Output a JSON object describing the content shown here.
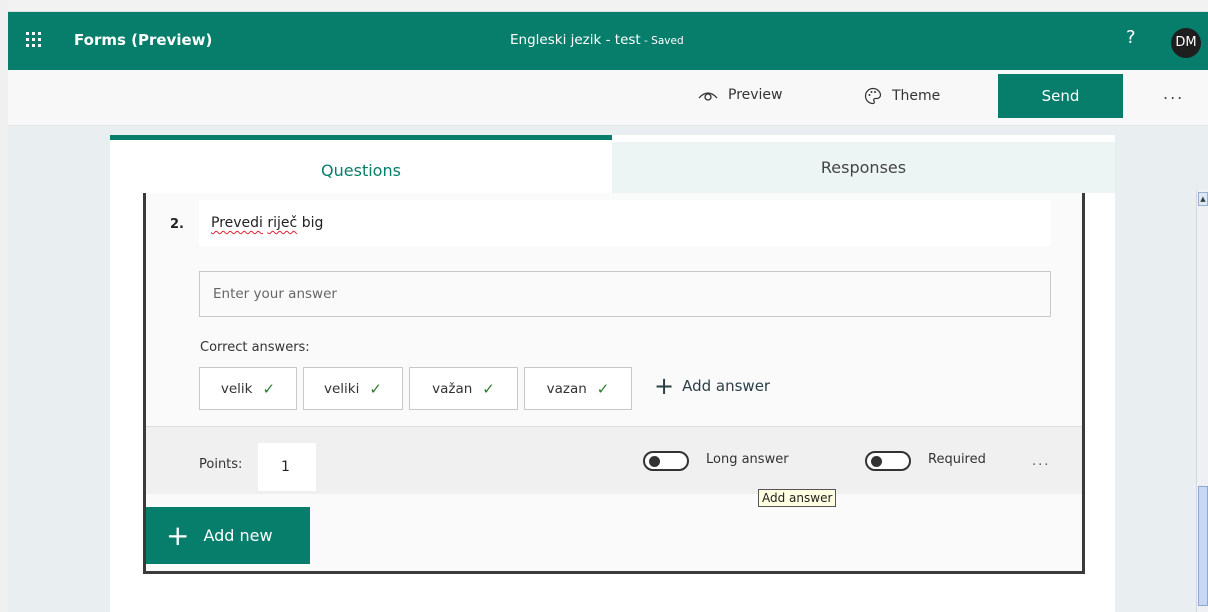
{
  "app_bar": {
    "app_name": "Forms (Preview)",
    "doc_title": "Engleski jezik - test",
    "save_sep": " - ",
    "save_status": "Saved",
    "help": "?",
    "user_initials": "DM",
    "background_color": "#077d6b"
  },
  "command_bar": {
    "preview_label": "Preview",
    "theme_label": "Theme",
    "send_label": "Send",
    "more_label": "..."
  },
  "tabs": {
    "questions": "Questions",
    "responses": "Responses"
  },
  "question": {
    "number": "2.",
    "title_word1": "Prevedi",
    "title_word2": "riječ",
    "title_word3": "big",
    "answer_placeholder": "Enter your answer",
    "correct_answers_label": "Correct answers:",
    "correct_answers": [
      "velik",
      "veliki",
      "važan",
      "vazan"
    ],
    "add_answer_label": "Add answer",
    "tooltip": "Add answer",
    "points_label": "Points:",
    "points_value": "1",
    "long_answer_label": "Long answer",
    "long_answer_on": false,
    "required_label": "Required",
    "required_on": false,
    "more_label": "..."
  },
  "add_new_label": "Add new",
  "colors": {
    "accent": "#077d6b",
    "check": "#2e7d32"
  }
}
